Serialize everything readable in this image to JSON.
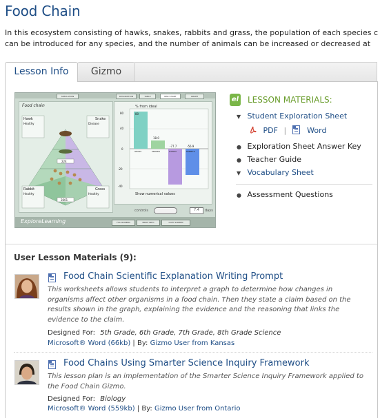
{
  "page": {
    "title": "Food Chain",
    "intro_line1": "In this ecosystem consisting of hawks, snakes, rabbits and grass, the population of each species c",
    "intro_line2": "can be introduced for any species, and the number of animals can be increased or decreased at"
  },
  "tabs": [
    {
      "label": "Lesson Info",
      "active": true
    },
    {
      "label": "Gizmo",
      "active": false
    }
  ],
  "gizmo_preview": {
    "tabs": [
      "SIMULATION",
      "DESCRIPTION",
      "TABLE",
      "BAR CHART",
      "GRAPH"
    ],
    "left_title": "Food chain",
    "hawk_label": "Hawk",
    "snake_label": "Snake",
    "rabbit_label": "Rabbit",
    "grass_label": "Grass",
    "healthy": "Healthy",
    "disease": "Disease",
    "count_top": "224",
    "count_bottom": "3601",
    "chart_title": "% from ideal",
    "bar_values": [
      "80",
      "18.0",
      "-77.7",
      "-56.9"
    ],
    "y_ticks": [
      "80",
      "40",
      "20",
      "0",
      "-20",
      "-40"
    ],
    "bar_categories": [
      "GRASS",
      "SNAKES",
      "HAWKS",
      "RABBITS"
    ],
    "show_values_label": "Show numerical values",
    "controls_label": "controls",
    "days_value": "7.4",
    "days_label": "days",
    "logo": "ExploreLearning",
    "bottom_buttons": [
      "FULLSCREEN",
      "PRINT INFO",
      "COPY SCREEN"
    ]
  },
  "lesson_materials": {
    "badge": "el",
    "heading": "LESSON MATERIALS:",
    "items": [
      {
        "label": "Student Exploration Sheet",
        "link": true,
        "marker": "▼"
      },
      {
        "label": "Exploration Sheet Answer Key",
        "link": false,
        "marker": "●"
      },
      {
        "label": "Teacher Guide",
        "link": false,
        "marker": "●"
      },
      {
        "label": "Vocabulary Sheet",
        "link": true,
        "marker": "▼"
      },
      {
        "label": "Assessment Questions",
        "link": false,
        "marker": "●"
      }
    ],
    "files": {
      "pdf": "PDF",
      "separator": "|",
      "word": "Word"
    }
  },
  "user_materials": {
    "heading": "User Lesson Materials (9):",
    "items": [
      {
        "title": "Food Chain Scientific Explanation Writing Prompt",
        "desc_lines": [
          "This worksheets allows students to interpret a graph to determine how changes in",
          "organisms affect other organisms in a food chain. Then they state a claim based on the",
          "results shown in the graph, explaining the evidence and the reasoning that links the",
          "evidence to the claim."
        ],
        "designed_for_label": "Designed For:",
        "designed_for": "5th Grade, 6th Grade, 7th Grade, 8th Grade Science",
        "file": "Microsoft® Word (66kb)",
        "by_label": "By:",
        "author": "Gizmo User from Kansas"
      },
      {
        "title": "Food Chains Using Smarter Science Inquiry Framework",
        "desc_lines": [
          "This lesson plan is an implementation of the Smarter Science Inquiry Framework applied to",
          "the Food Chain Gizmo."
        ],
        "designed_for_label": "Designed For:",
        "designed_for": "Biology",
        "file": "Microsoft® Word (559kb)",
        "by_label": "By:",
        "author": "Gizmo User from Ontario"
      }
    ]
  },
  "colors": {
    "link": "#1f4e86",
    "accent_green": "#6a9d2d",
    "bar_grass": "#7fd1c4",
    "bar_snakes": "#9fd4a0",
    "bar_hawks": "#b79ae0",
    "bar_rabbits": "#5f8fe8"
  }
}
